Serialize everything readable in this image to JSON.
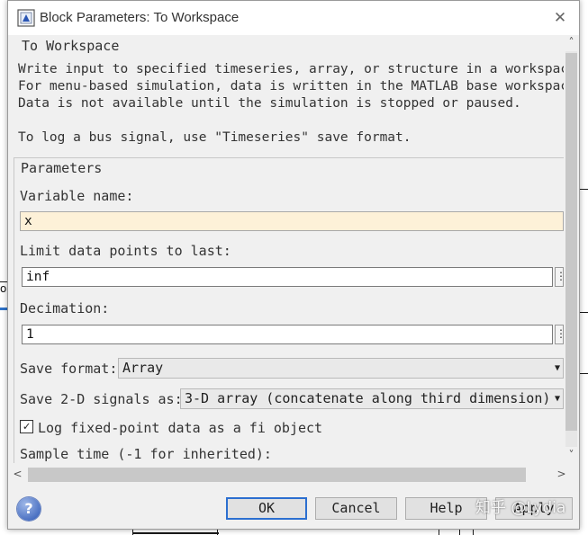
{
  "dialog": {
    "title": "Block Parameters: To Workspace",
    "close_glyph": "✕"
  },
  "block": {
    "name": "To Workspace",
    "description": [
      "Write input to specified timeseries, array, or structure in a workspace",
      "For menu-based simulation, data is written in the MATLAB base workspace",
      "Data is not available until the simulation is stopped or paused.",
      "To log a bus signal, use \"Timeseries\" save format."
    ]
  },
  "parameters": {
    "legend": "Parameters",
    "variable_name": {
      "label": "Variable name:",
      "value": "x"
    },
    "limit_points": {
      "label": "Limit data points to last:",
      "value": "inf"
    },
    "decimation": {
      "label": "Decimation:",
      "value": "1"
    },
    "save_format": {
      "label": "Save format:",
      "value": "Array"
    },
    "save_2d": {
      "label": "Save 2-D signals as:",
      "value": "3-D array (concatenate along third dimension)"
    },
    "log_fixed_point": {
      "label": "Log fixed-point data as a fi object",
      "checked": true,
      "mark": "✓"
    },
    "sample_time": {
      "label": "Sample time (-1 for inherited):"
    },
    "side_button_glyph": "⋮"
  },
  "scrollbars": {
    "up": "˄",
    "down": "˅",
    "left": "<",
    "right": ">"
  },
  "buttons": {
    "help_icon": "?",
    "ok": "OK",
    "cancel": "Cancel",
    "help": "Help",
    "apply": "Apply"
  },
  "watermark": "知乎 @Lydia",
  "icons": {
    "title": "simulink-block-icon",
    "help": "help-question-icon"
  },
  "colors": {
    "dialog_bg": "#f0f0f0",
    "highlight_field": "#fdf1d8",
    "default_button_border": "#2c6fd0"
  }
}
